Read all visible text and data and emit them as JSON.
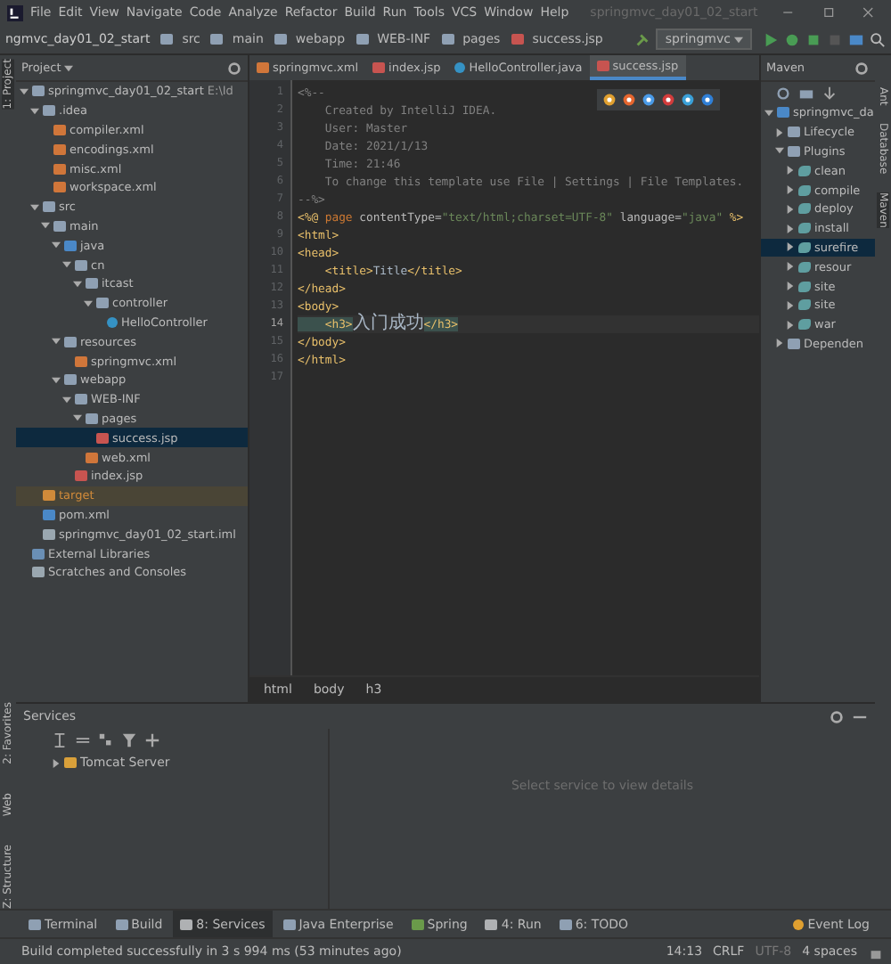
{
  "menu_bar": {
    "items": [
      "File",
      "Edit",
      "View",
      "Navigate",
      "Code",
      "Analyze",
      "Refactor",
      "Build",
      "Run",
      "Tools",
      "VCS",
      "Window",
      "Help"
    ],
    "title": "springmvc_day01_02_start"
  },
  "nav_bar": {
    "crumbs": [
      {
        "label": "ngmvc_day01_02_start",
        "kind": "module"
      },
      {
        "label": "src",
        "kind": "folder"
      },
      {
        "label": "main",
        "kind": "folder"
      },
      {
        "label": "webapp",
        "kind": "folder"
      },
      {
        "label": "WEB-INF",
        "kind": "folder"
      },
      {
        "label": "pages",
        "kind": "folder"
      },
      {
        "label": "success.jsp",
        "kind": "jsp"
      }
    ],
    "run_config": "springmvc"
  },
  "left_strip": [
    {
      "label": "1: Project",
      "selected": true
    },
    {
      "label": "2: Favorites",
      "selected": false
    },
    {
      "label": "Web",
      "selected": false
    },
    {
      "label": "Z: Structure",
      "selected": false
    }
  ],
  "right_strip": [
    {
      "label": "Ant",
      "selected": false
    },
    {
      "label": "Database",
      "selected": false
    },
    {
      "label": "Maven",
      "selected": true
    }
  ],
  "project": {
    "header": "Project",
    "tree": [
      {
        "label": "springmvc_day01_02_start",
        "hint": "E:\\Id",
        "kind": "module",
        "expanded": true,
        "selected": false,
        "children": [
          {
            "label": ".idea",
            "kind": "folder",
            "expanded": true,
            "selected": false,
            "children": [
              {
                "label": "compiler.xml",
                "kind": "xml",
                "selected": false
              },
              {
                "label": "encodings.xml",
                "kind": "xml",
                "selected": false
              },
              {
                "label": "misc.xml",
                "kind": "xml",
                "selected": false
              },
              {
                "label": "workspace.xml",
                "kind": "xml",
                "selected": false
              }
            ]
          },
          {
            "label": "src",
            "kind": "folder",
            "expanded": true,
            "selected": false,
            "children": [
              {
                "label": "main",
                "kind": "folder",
                "expanded": true,
                "selected": false,
                "children": [
                  {
                    "label": "java",
                    "kind": "source",
                    "expanded": true,
                    "selected": false,
                    "children": [
                      {
                        "label": "cn",
                        "kind": "package",
                        "expanded": true,
                        "selected": false,
                        "children": [
                          {
                            "label": "itcast",
                            "kind": "package",
                            "expanded": true,
                            "selected": false,
                            "children": [
                              {
                                "label": "controller",
                                "kind": "package",
                                "expanded": true,
                                "selected": false,
                                "children": [
                                  {
                                    "label": "HelloController",
                                    "kind": "class",
                                    "selected": false
                                  }
                                ]
                              }
                            ]
                          }
                        ]
                      }
                    ]
                  },
                  {
                    "label": "resources",
                    "kind": "resources",
                    "expanded": true,
                    "selected": false,
                    "children": [
                      {
                        "label": "springmvc.xml",
                        "kind": "xml",
                        "selected": false
                      }
                    ]
                  },
                  {
                    "label": "webapp",
                    "kind": "folder",
                    "expanded": true,
                    "selected": false,
                    "children": [
                      {
                        "label": "WEB-INF",
                        "kind": "folder",
                        "expanded": true,
                        "selected": false,
                        "children": [
                          {
                            "label": "pages",
                            "kind": "folder",
                            "expanded": true,
                            "selected": false,
                            "children": [
                              {
                                "label": "success.jsp",
                                "kind": "jsp",
                                "selected": true
                              }
                            ]
                          },
                          {
                            "label": "web.xml",
                            "kind": "xml",
                            "selected": false
                          }
                        ]
                      },
                      {
                        "label": "index.jsp",
                        "kind": "jsp",
                        "selected": false
                      }
                    ]
                  }
                ]
              }
            ]
          },
          {
            "label": "target",
            "kind": "excluded",
            "selected": false
          },
          {
            "label": "pom.xml",
            "kind": "maven",
            "selected": false
          },
          {
            "label": "springmvc_day01_02_start.iml",
            "kind": "iml",
            "selected": false
          }
        ]
      },
      {
        "label": "External Libraries",
        "kind": "library",
        "selected": false
      },
      {
        "label": "Scratches and Consoles",
        "kind": "scratch",
        "selected": false
      }
    ]
  },
  "editor": {
    "tabs": [
      {
        "label": "springmvc.xml",
        "kind": "xml",
        "selected": false
      },
      {
        "label": "index.jsp",
        "kind": "jsp",
        "selected": false
      },
      {
        "label": "HelloController.java",
        "kind": "class",
        "selected": false
      },
      {
        "label": "success.jsp",
        "kind": "jsp",
        "selected": true
      }
    ],
    "lines": [
      {
        "number": "1",
        "current": false,
        "tokens": [
          {
            "text": "<%--",
            "kind": "comment"
          }
        ]
      },
      {
        "number": "2",
        "current": false,
        "tokens": [
          {
            "text": "    Created by IntelliJ IDEA.",
            "kind": "comment"
          }
        ]
      },
      {
        "number": "3",
        "current": false,
        "tokens": [
          {
            "text": "    User: Master",
            "kind": "comment"
          }
        ]
      },
      {
        "number": "4",
        "current": false,
        "tokens": [
          {
            "text": "    Date: 2021/1/13",
            "kind": "comment"
          }
        ]
      },
      {
        "number": "5",
        "current": false,
        "tokens": [
          {
            "text": "    Time: 21:46",
            "kind": "comment"
          }
        ]
      },
      {
        "number": "6",
        "current": false,
        "tokens": [
          {
            "text": "    To change this template use File | Settings | File Templates.",
            "kind": "comment"
          }
        ]
      },
      {
        "number": "7",
        "current": false,
        "tokens": [
          {
            "text": "--%>",
            "kind": "comment"
          }
        ]
      },
      {
        "number": "8",
        "current": false,
        "tokens": [
          {
            "text": "<%@ ",
            "kind": "directive"
          },
          {
            "text": "page ",
            "kind": "keyword"
          },
          {
            "text": "contentType=",
            "kind": "attr"
          },
          {
            "text": "\"text/html;charset=UTF-8\"",
            "kind": "string"
          },
          {
            "text": " language=",
            "kind": "attr"
          },
          {
            "text": "\"java\"",
            "kind": "string"
          },
          {
            "text": " %>",
            "kind": "directive"
          }
        ]
      },
      {
        "number": "9",
        "current": false,
        "tokens": [
          {
            "text": "<html>",
            "kind": "tag"
          }
        ]
      },
      {
        "number": "10",
        "current": false,
        "tokens": [
          {
            "text": "<head>",
            "kind": "tag"
          }
        ]
      },
      {
        "number": "11",
        "current": false,
        "tokens": [
          {
            "text": "    <title>",
            "kind": "tag"
          },
          {
            "text": "Title",
            "kind": "plain"
          },
          {
            "text": "</title>",
            "kind": "tag"
          }
        ]
      },
      {
        "number": "12",
        "current": false,
        "tokens": [
          {
            "text": "</head>",
            "kind": "tag"
          }
        ]
      },
      {
        "number": "13",
        "current": false,
        "tokens": [
          {
            "text": "<body>",
            "kind": "tag"
          }
        ]
      },
      {
        "number": "14",
        "current": true,
        "tokens": [
          {
            "text": "    <h3>",
            "kind": "match"
          },
          {
            "text": "入门成功",
            "kind": "cjk"
          },
          {
            "text": "</h3>",
            "kind": "match"
          }
        ]
      },
      {
        "number": "15",
        "current": false,
        "tokens": [
          {
            "text": "</body>",
            "kind": "tag"
          }
        ]
      },
      {
        "number": "16",
        "current": false,
        "tokens": [
          {
            "text": "</html>",
            "kind": "tag"
          }
        ]
      },
      {
        "number": "17",
        "current": false
      }
    ],
    "breadcrumbs": [
      "html",
      "body",
      "h3"
    ]
  },
  "maven": {
    "header": "Maven",
    "tree": [
      {
        "label": "springmvc_da",
        "kind": "project",
        "expanded": true,
        "selected": false,
        "children": [
          {
            "label": "Lifecycle",
            "kind": "folder",
            "expanded": false,
            "selected": false
          },
          {
            "label": "Plugins",
            "kind": "folder",
            "expanded": true,
            "selected": false,
            "children": [
              {
                "label": "clean",
                "kind": "plugin",
                "expanded": false,
                "selected": false
              },
              {
                "label": "compile",
                "kind": "plugin",
                "expanded": false,
                "selected": false
              },
              {
                "label": "deploy",
                "kind": "plugin",
                "expanded": false,
                "selected": false
              },
              {
                "label": "install",
                "kind": "plugin",
                "expanded": false,
                "selected": false
              },
              {
                "label": "surefire",
                "kind": "plugin",
                "expanded": false,
                "selected": true
              },
              {
                "label": "resour",
                "kind": "plugin",
                "expanded": false,
                "selected": false
              },
              {
                "label": "site",
                "kind": "plugin",
                "expanded": false,
                "selected": false
              },
              {
                "label": "site",
                "kind": "plugin",
                "expanded": false,
                "selected": false
              },
              {
                "label": "war",
                "kind": "plugin",
                "expanded": false,
                "selected": false
              }
            ]
          },
          {
            "label": "Dependen",
            "kind": "folder",
            "expanded": false,
            "selected": false
          }
        ]
      }
    ]
  },
  "services": {
    "title": "Services",
    "items": [
      {
        "label": "Tomcat Server",
        "expanded": false
      }
    ],
    "empty_text": "Select service to view details"
  },
  "tool_tabs": [
    {
      "label": "Terminal",
      "kind": "terminal",
      "selected": false
    },
    {
      "label": "Build",
      "kind": "build",
      "selected": false
    },
    {
      "label": "8: Services",
      "kind": "services",
      "selected": true
    },
    {
      "label": "Java Enterprise",
      "kind": "enterprise",
      "selected": false
    },
    {
      "label": "Spring",
      "kind": "spring",
      "selected": false
    },
    {
      "label": "4: Run",
      "kind": "run",
      "selected": false
    },
    {
      "label": "6: TODO",
      "kind": "todo",
      "selected": false
    }
  ],
  "event_log": "Event Log",
  "status_bar": {
    "message": "Build completed successfully in 3 s 994 ms (53 minutes ago)",
    "position": "14:13",
    "line_sep": "CRLF",
    "encoding": "UTF-8",
    "indent": "4 spaces"
  }
}
